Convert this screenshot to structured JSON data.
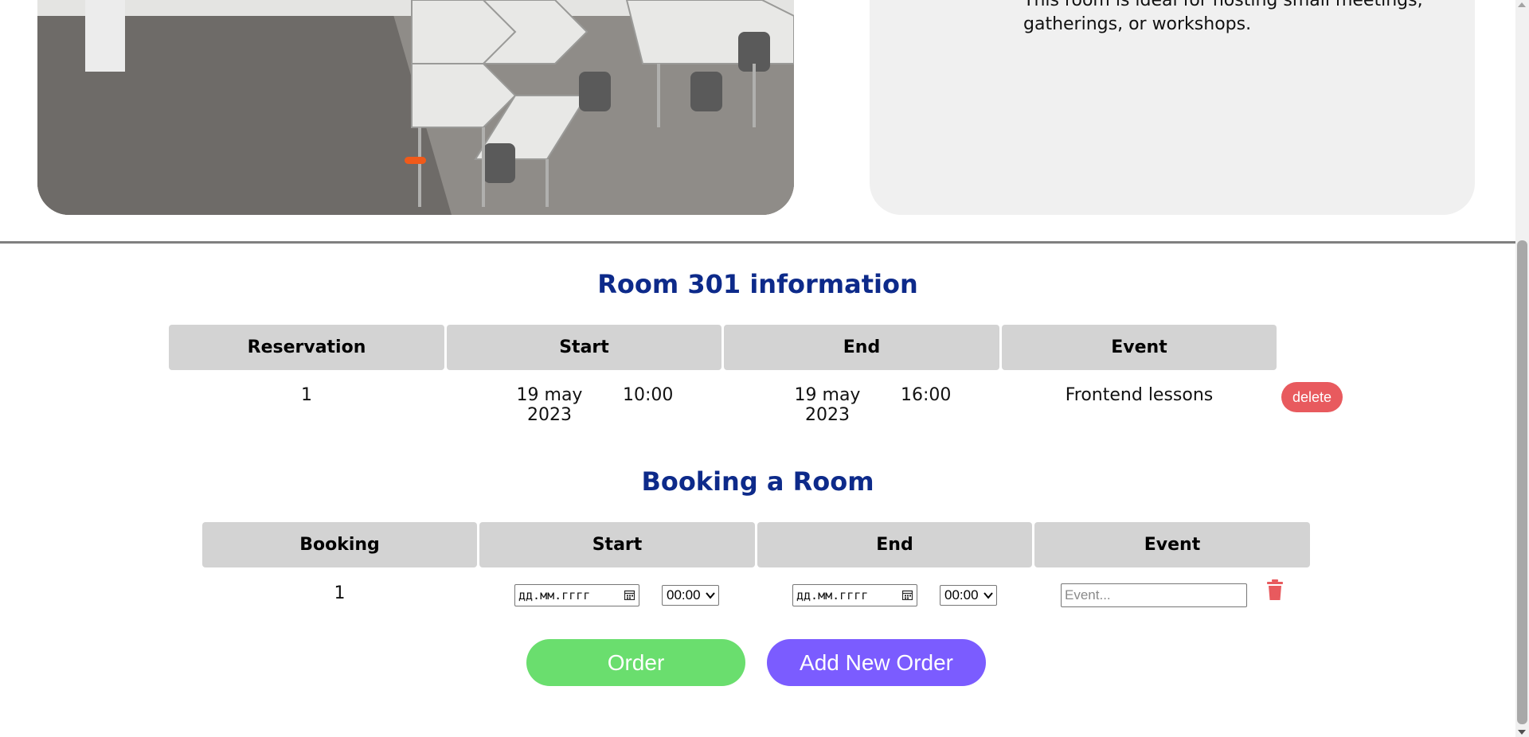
{
  "room_description": {
    "lines": [
      "This room is ideal for hosting small meetings,",
      "gatherings, or workshops."
    ]
  },
  "info_section": {
    "title": "Room 301 information",
    "headers": [
      "Reservation",
      "Start",
      "End",
      "Event"
    ],
    "rows": [
      {
        "reservation": "1",
        "start_date": "19 may 2023",
        "start_time": "10:00",
        "end_date": "19 may 2023",
        "end_time": "16:00",
        "event": "Frontend lessons",
        "delete_label": "delete"
      }
    ]
  },
  "booking_section": {
    "title": "Booking a Room",
    "headers": [
      "Booking",
      "Start",
      "End",
      "Event"
    ],
    "row": {
      "booking": "1",
      "start_date_placeholder": "дд.мм.гггг",
      "start_time": "00:00",
      "end_date_placeholder": "дд.мм.гггг",
      "end_time": "00:00",
      "event_placeholder": "Event..."
    }
  },
  "actions": {
    "order_label": "Order",
    "add_label": "Add New Order"
  },
  "colors": {
    "title": "#0d2a8a",
    "delete": "#e85a5e",
    "order": "#6ade6e",
    "add": "#7b5cff",
    "header_bg": "#d3d3d3",
    "slider_dot": "#f05a1a"
  },
  "icons": [
    "calendar-icon",
    "chevron-down-icon",
    "trash-icon"
  ]
}
